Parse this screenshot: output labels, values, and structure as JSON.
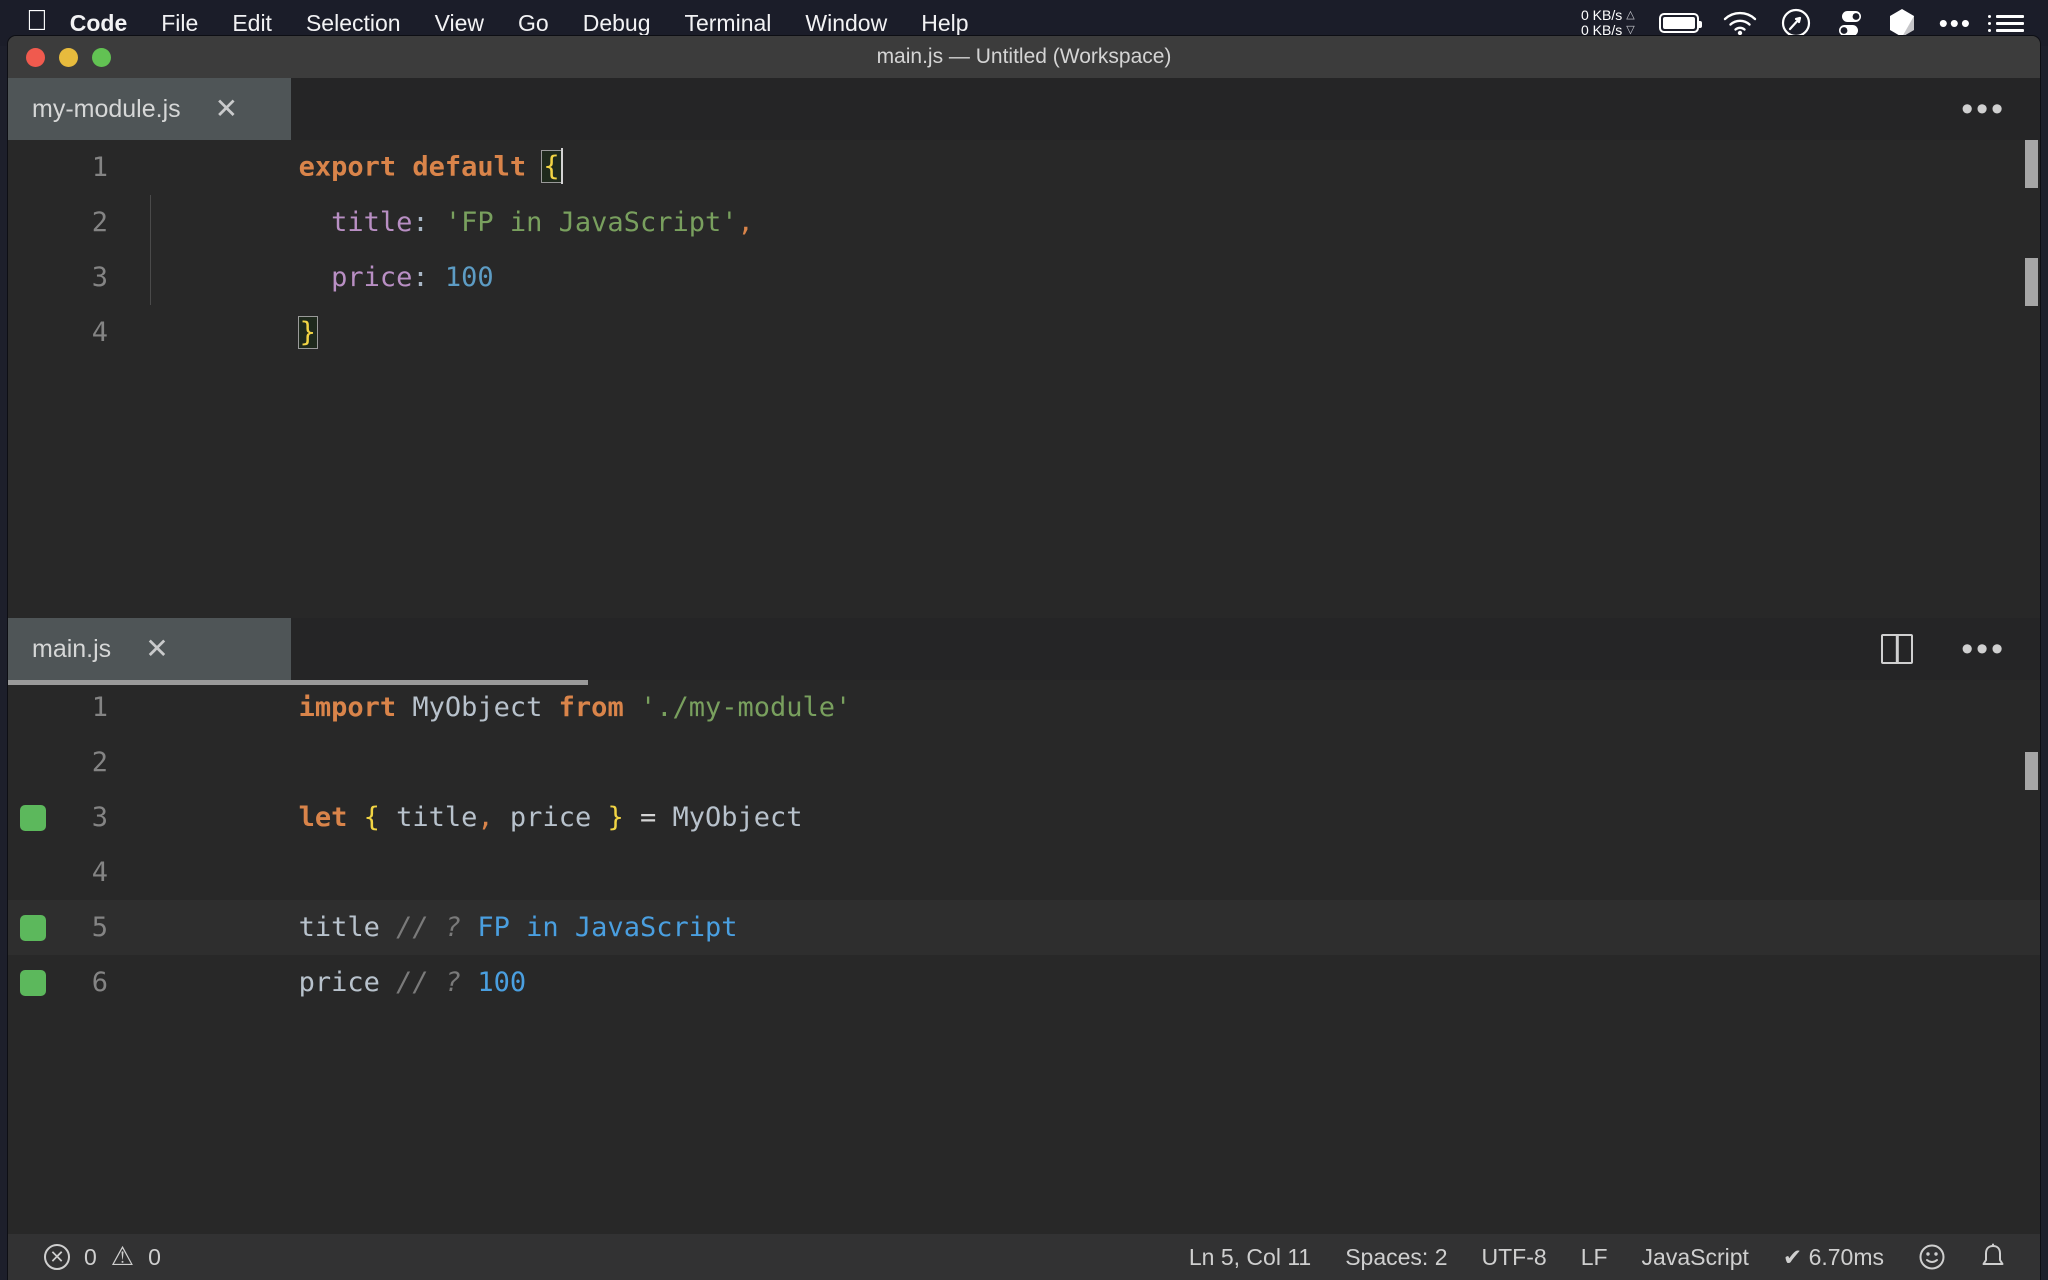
{
  "menubar": {
    "apple_glyph": "",
    "items": [
      {
        "label": "Code",
        "bold": true
      },
      {
        "label": "File",
        "bold": false
      },
      {
        "label": "Edit",
        "bold": false
      },
      {
        "label": "Selection",
        "bold": false
      },
      {
        "label": "View",
        "bold": false
      },
      {
        "label": "Go",
        "bold": false
      },
      {
        "label": "Debug",
        "bold": false
      },
      {
        "label": "Terminal",
        "bold": false
      },
      {
        "label": "Window",
        "bold": false
      },
      {
        "label": "Help",
        "bold": false
      }
    ],
    "network": {
      "up": "0 KB/s",
      "down": "0 KB/s",
      "up_tri": "△",
      "down_tri": "▽"
    },
    "status_icons": [
      "battery-icon",
      "wifi-icon",
      "compass-icon",
      "toggles-icon",
      "shard-icon",
      "ellipsis-icon",
      "list-icon"
    ]
  },
  "window": {
    "title": "main.js — Untitled (Workspace)",
    "traffic_lights": [
      "close",
      "minimize",
      "zoom"
    ]
  },
  "editor_top": {
    "tab": {
      "label": "my-module.js",
      "close": "✕"
    },
    "actions": {
      "more": "•••"
    },
    "lines": [
      {
        "num": "1",
        "marker": false,
        "highlight": false
      },
      {
        "num": "2",
        "marker": false,
        "highlight": false
      },
      {
        "num": "3",
        "marker": false,
        "highlight": false
      },
      {
        "num": "4",
        "marker": false,
        "highlight": false
      }
    ],
    "code": {
      "l1_kw": "export default ",
      "l1_brace": "{",
      "l2_prop": "  title",
      "l2_colon": ": ",
      "l2_str": "'FP in JavaScript'",
      "l2_comma": ",",
      "l3_prop": "  price",
      "l3_colon": ": ",
      "l3_num": "100",
      "l4_brace": "}"
    }
  },
  "editor_bottom": {
    "tab": {
      "label": "main.js",
      "close": "✕"
    },
    "actions": {
      "split": "split-editor",
      "more": "•••"
    },
    "lines": [
      {
        "num": "1",
        "marker": false,
        "highlight": false
      },
      {
        "num": "2",
        "marker": false,
        "highlight": false
      },
      {
        "num": "3",
        "marker": true,
        "highlight": false
      },
      {
        "num": "4",
        "marker": false,
        "highlight": false
      },
      {
        "num": "5",
        "marker": true,
        "highlight": true
      },
      {
        "num": "6",
        "marker": true,
        "highlight": false
      }
    ],
    "code": {
      "l1_kw": "import ",
      "l1_var": "MyObject ",
      "l1_from": "from ",
      "l1_str": "'./my-module'",
      "l3_kw": "let ",
      "l3_ob": "{",
      "l3_t": " title",
      "l3_comma": ",",
      "l3_p": " price ",
      "l3_cb": "}",
      "l3_eq": " = ",
      "l3_obj": "MyObject",
      "l5_var": "title ",
      "l5_comment": "// ? ",
      "l5_val": "FP in JavaScript",
      "l6_var": "price ",
      "l6_comment": "// ? ",
      "l6_val": "100"
    }
  },
  "statusbar": {
    "errors_icon": "✕",
    "errors_count": "0",
    "warnings_icon": "⚠",
    "warnings_count": "0",
    "cursor": "Ln 5, Col 11",
    "indentation": "Spaces: 2",
    "encoding": "UTF-8",
    "eol": "LF",
    "language": "JavaScript",
    "quokka": "✔ 6.70ms",
    "feedback_icon": "☺",
    "bell_icon": "🔔"
  },
  "colors": {
    "menubar_bg": "#1b1d29",
    "titlebar_bg": "#3c3c3c",
    "tabbar_bg": "#252526",
    "tab_active_bg": "#4f5557",
    "editor_bg": "#282828",
    "statusbar_bg": "#323233",
    "keyword": "#d9844a",
    "string": "#79a05e",
    "number": "#5d9cc4",
    "property": "#b98fc4",
    "brace": "#f2d544",
    "quokka_marker": "#5cb85c",
    "quokka_value": "#4a9fe0",
    "comment": "#7a7a7a"
  }
}
